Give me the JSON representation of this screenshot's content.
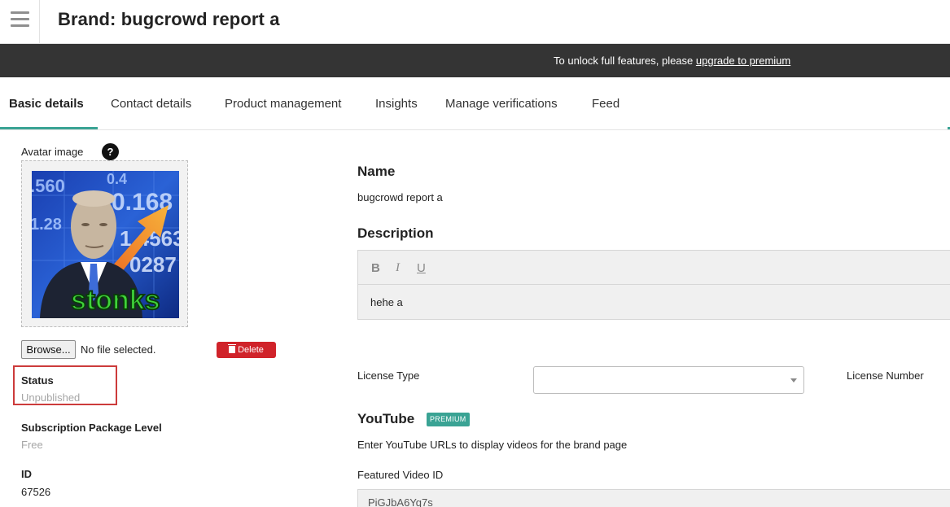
{
  "header": {
    "title": "Brand: bugcrowd report a",
    "menu_icon": "hamburger-menu-icon"
  },
  "banner": {
    "text": "To unlock full features, please ",
    "link": "upgrade to premium"
  },
  "tabs": [
    {
      "label": "Basic details",
      "active": true
    },
    {
      "label": "Contact details",
      "active": false
    },
    {
      "label": "Product management",
      "active": false
    },
    {
      "label": "Insights",
      "active": false
    },
    {
      "label": "Manage verifications",
      "active": false
    },
    {
      "label": "Feed",
      "active": false
    }
  ],
  "avatar": {
    "label": "Avatar image",
    "help": "?",
    "image_text": {
      "caption": "stonks",
      "numbers": [
        ".560",
        "0.168",
        "1.28",
        "1.4563",
        "0287",
        "0.4"
      ]
    },
    "browse_label": "Browse...",
    "file_status": "No file selected.",
    "delete_label": "Delete"
  },
  "status": {
    "label": "Status",
    "value": "Unpublished"
  },
  "subscription": {
    "label": "Subscription Package Level",
    "value": "Free"
  },
  "id_field": {
    "label": "ID",
    "value": "67526"
  },
  "name": {
    "label": "Name",
    "value": "bugcrowd report a"
  },
  "description": {
    "label": "Description",
    "toolbar": {
      "bold": "B",
      "italic": "I",
      "underline": "U"
    },
    "value": "hehe a"
  },
  "license": {
    "type_label": "License Type",
    "type_value": "",
    "number_label": "License Number"
  },
  "youtube": {
    "label": "YouTube",
    "badge": "PREMIUM",
    "help": "Enter YouTube URLs to display videos for the brand page",
    "featured_label": "Featured Video ID",
    "featured_value": "PiGJbA6Yq7s"
  },
  "colors": {
    "accent": "#3aa394",
    "banner_bg": "#343434",
    "delete": "#d0232a",
    "highlight_border": "#cc3b3b"
  }
}
